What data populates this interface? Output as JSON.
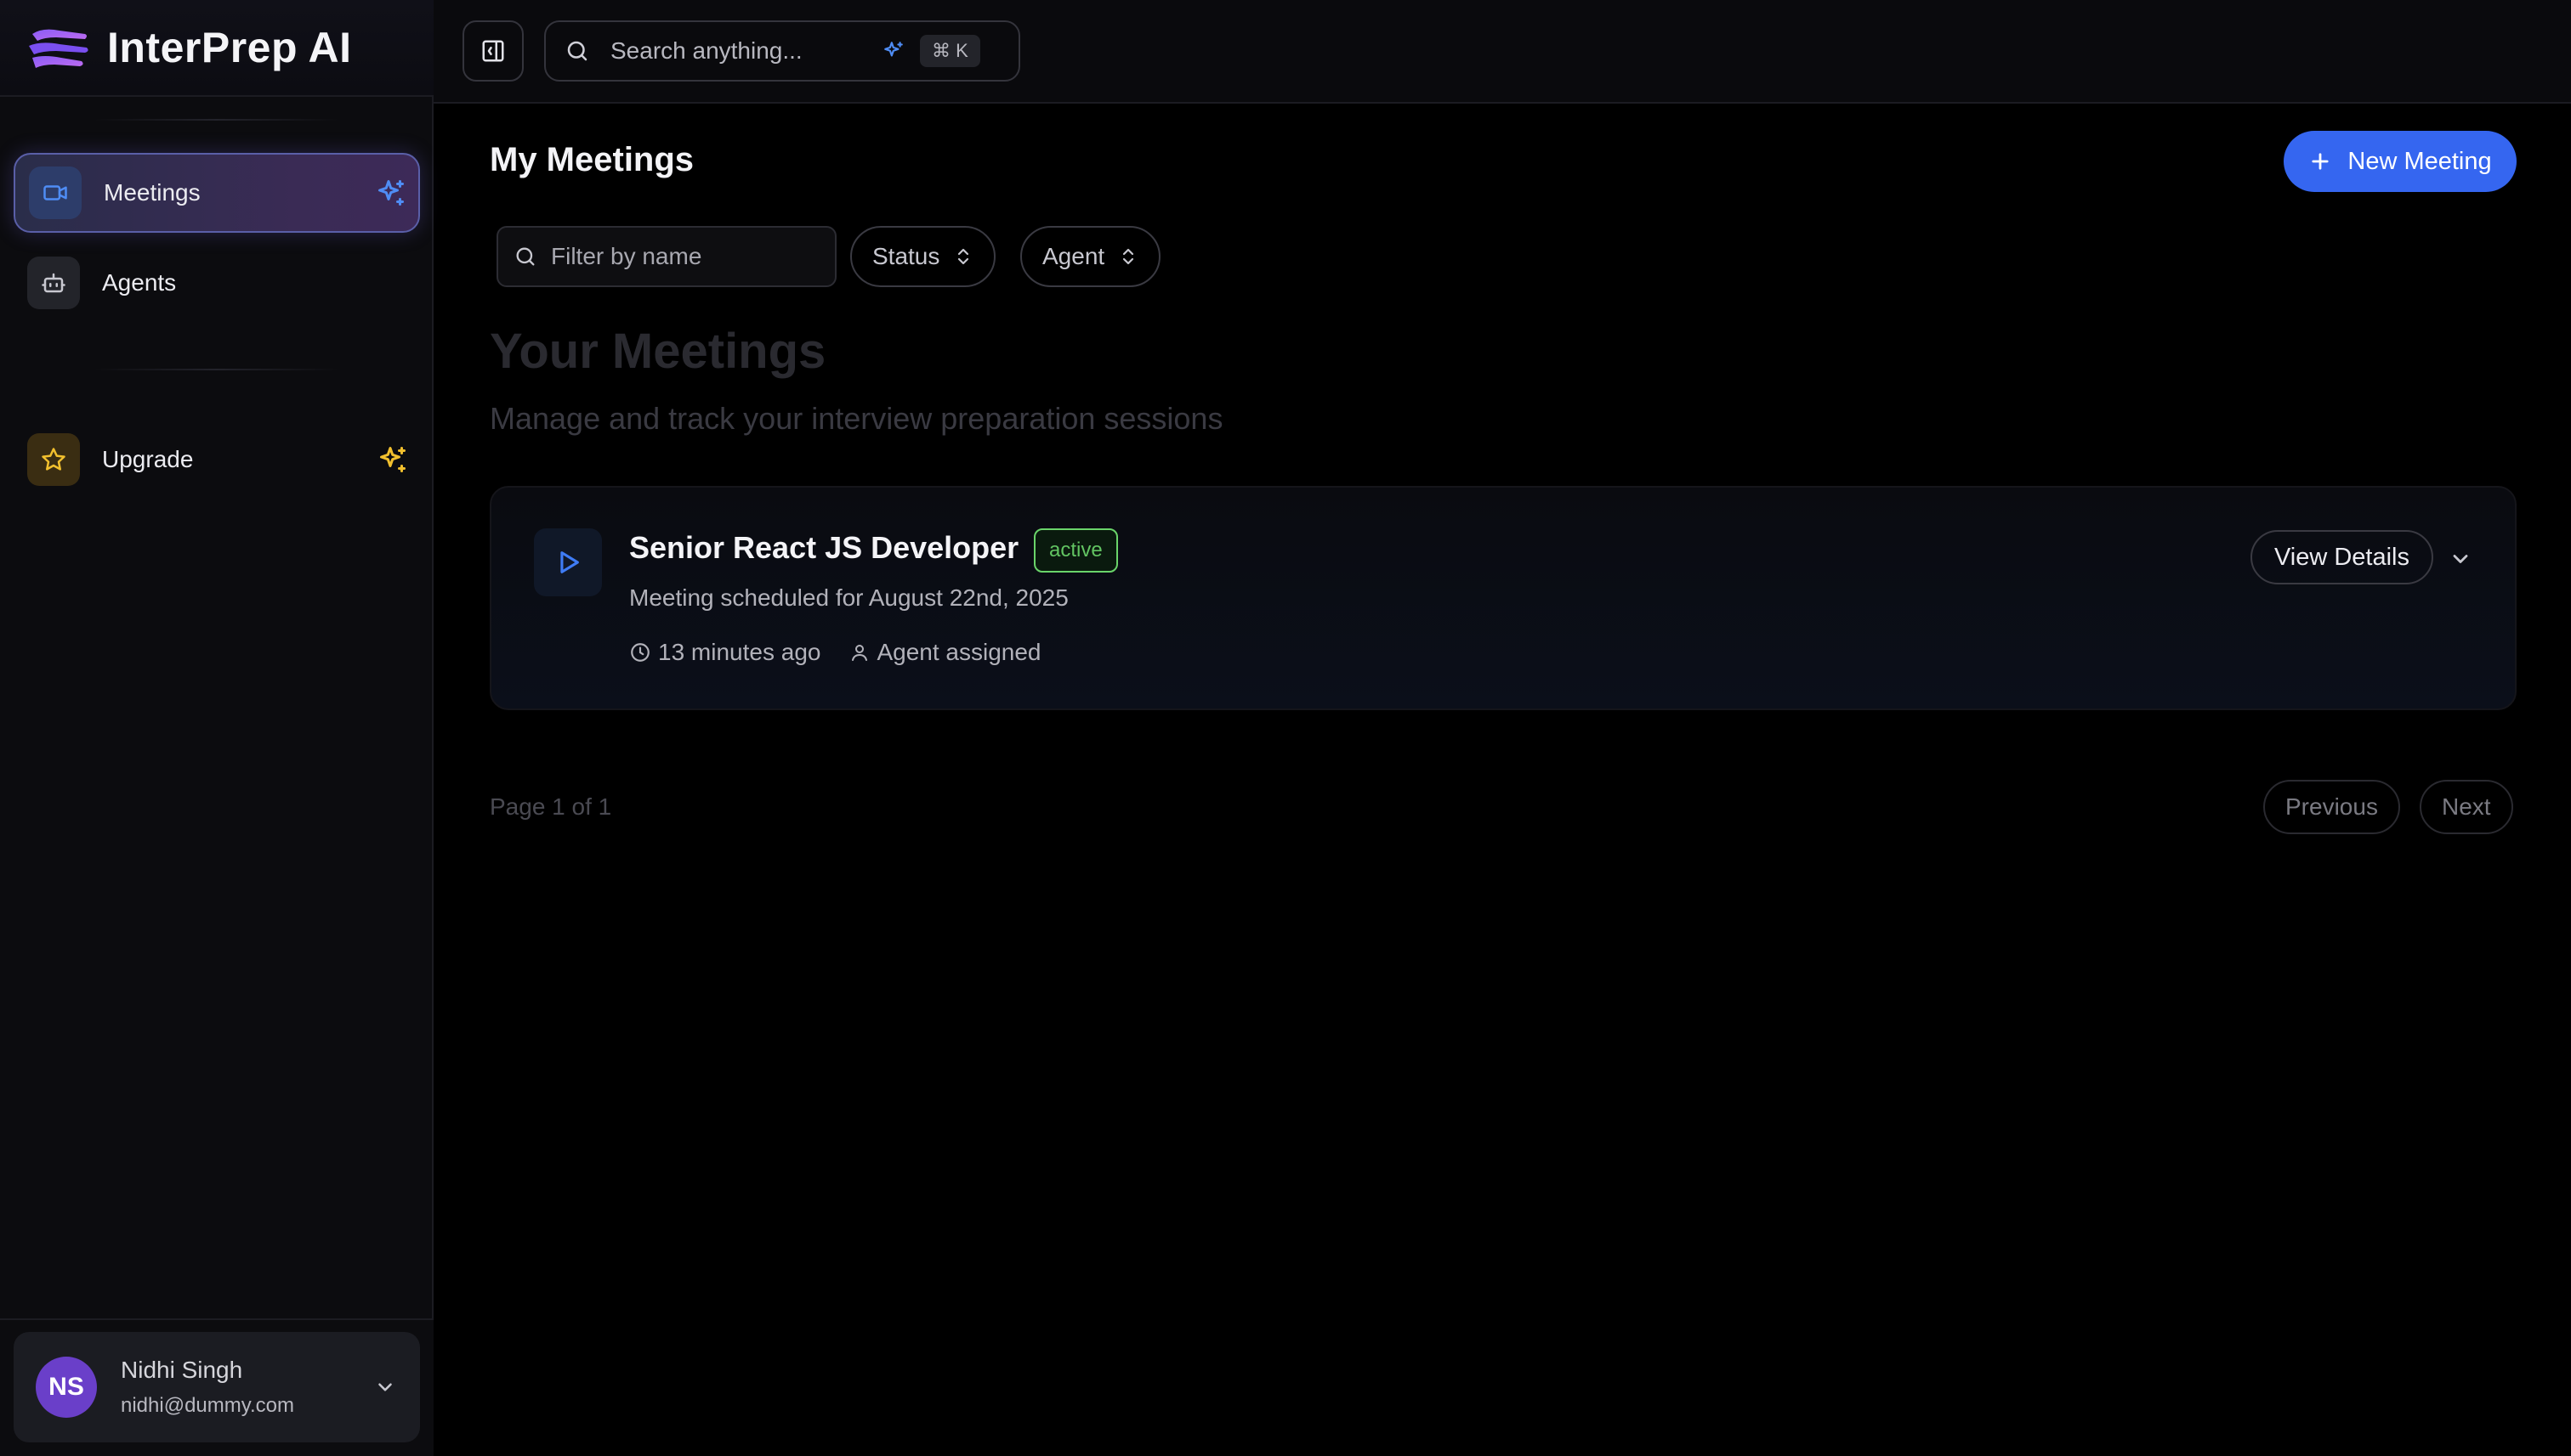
{
  "brand": {
    "name": "InterPrep AI"
  },
  "sidebar": {
    "items": [
      {
        "label": "Meetings",
        "icon": "video-icon",
        "active": true
      },
      {
        "label": "Agents",
        "icon": "bot-icon",
        "active": false
      }
    ],
    "upgrade": {
      "label": "Upgrade",
      "icon": "star-icon"
    }
  },
  "user": {
    "initials": "NS",
    "name": "Nidhi Singh",
    "email": "nidhi@dummy.com"
  },
  "topbar": {
    "search_placeholder": "Search anything...",
    "shortcut": "⌘ K"
  },
  "main": {
    "title": "My Meetings",
    "new_button": "New Meeting",
    "filter_placeholder": "Filter by name",
    "status_filter": "Status",
    "agent_filter": "Agent",
    "hero_title": "Your Meetings",
    "hero_subtitle": "Manage and track your interview preparation sessions",
    "meetings": [
      {
        "title": "Senior React JS Developer",
        "status": "active",
        "subtitle": "Meeting scheduled for August 22nd, 2025",
        "time_ago": "13 minutes ago",
        "agent": "Agent assigned",
        "view_label": "View Details"
      }
    ],
    "pagination": {
      "info": "Page 1 of 1",
      "prev": "Previous",
      "next": "Next"
    }
  },
  "colors": {
    "accent": "#3566f0",
    "active_status": "#62c462",
    "avatar": "#6a3fc9"
  }
}
